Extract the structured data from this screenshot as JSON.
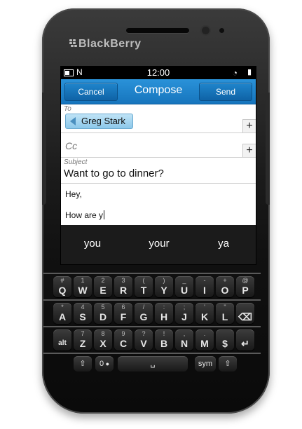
{
  "device": {
    "brand": "BlackBerry"
  },
  "status_bar": {
    "time": "12:00",
    "carrier_indicator": "N"
  },
  "compose": {
    "title": "Compose",
    "cancel_label": "Cancel",
    "send_label": "Send",
    "to_label": "To",
    "recipient": "Greg Stark",
    "cc_placeholder": "Cc",
    "subject_label": "Subject",
    "subject": "Want to go to dinner?",
    "body_line1": "Hey,",
    "body_line2": "How are y",
    "add_icon": "+"
  },
  "suggestions": [
    "you",
    "your",
    "ya"
  ],
  "keyboard": {
    "row1": [
      {
        "sec": "#",
        "pri": "Q"
      },
      {
        "sec": "1",
        "pri": "W"
      },
      {
        "sec": "2",
        "pri": "E"
      },
      {
        "sec": "3",
        "pri": "R"
      },
      {
        "sec": "(",
        "pri": "T"
      },
      {
        "sec": ")",
        "pri": "Y"
      },
      {
        "sec": "_",
        "pri": "U"
      },
      {
        "sec": "-",
        "pri": "I"
      },
      {
        "sec": "+",
        "pri": "O"
      },
      {
        "sec": "@",
        "pri": "P"
      }
    ],
    "row2": [
      {
        "sec": "*",
        "pri": "A"
      },
      {
        "sec": "4",
        "pri": "S"
      },
      {
        "sec": "5",
        "pri": "D"
      },
      {
        "sec": "6",
        "pri": "F"
      },
      {
        "sec": "/",
        "pri": "G"
      },
      {
        "sec": ":",
        "pri": "H"
      },
      {
        "sec": ";",
        "pri": "J"
      },
      {
        "sec": "'",
        "pri": "K"
      },
      {
        "sec": "\"",
        "pri": "L"
      },
      {
        "sec": "",
        "pri": "⌫"
      }
    ],
    "row3": [
      {
        "sec": "",
        "pri": "alt"
      },
      {
        "sec": "7",
        "pri": "Z"
      },
      {
        "sec": "8",
        "pri": "X"
      },
      {
        "sec": "9",
        "pri": "C"
      },
      {
        "sec": "?",
        "pri": "V"
      },
      {
        "sec": "!",
        "pri": "B"
      },
      {
        "sec": ",",
        "pri": "N"
      },
      {
        "sec": ".",
        "pri": "M"
      },
      {
        "sec": "",
        "pri": "$"
      },
      {
        "sec": "",
        "pri": "↵"
      }
    ],
    "row4": {
      "shift_left": "⇧",
      "zero": "0",
      "mic": "🎤",
      "space": "␣",
      "sym": "sym",
      "shift_right": "⇧"
    }
  }
}
